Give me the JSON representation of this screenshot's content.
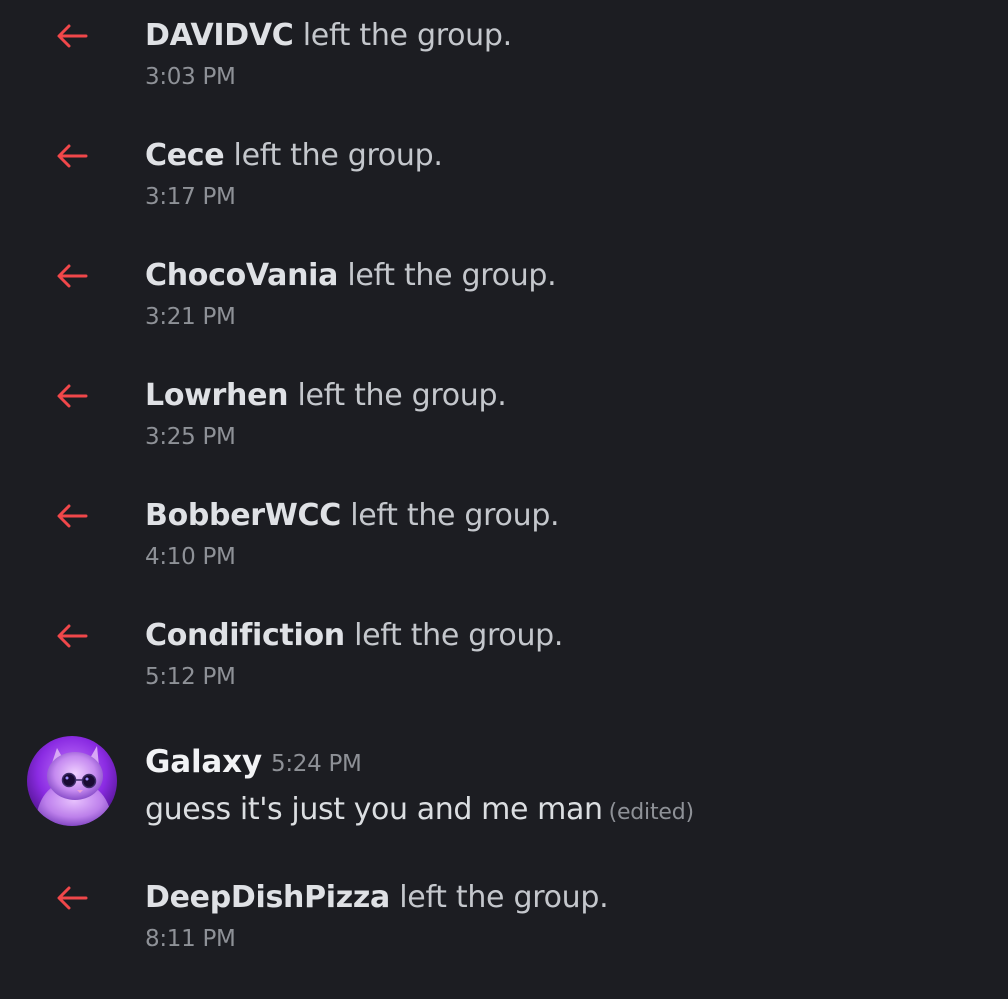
{
  "events": [
    {
      "username": "DAVIDVC",
      "text": " left the group.",
      "time": "3:03 PM"
    },
    {
      "username": "Cece",
      "text": " left the group.",
      "time": "3:17 PM"
    },
    {
      "username": "ChocoVania",
      "text": " left the group.",
      "time": "3:21 PM"
    },
    {
      "username": "Lowrhen",
      "text": " left the group.",
      "time": "3:25 PM"
    },
    {
      "username": "BobberWCC",
      "text": " left the group.",
      "time": "4:10 PM"
    },
    {
      "username": "Condifiction",
      "text": " left the group.",
      "time": "5:12 PM"
    }
  ],
  "message": {
    "author": "Galaxy",
    "time": "5:24 PM",
    "content": "guess it's just you and me man",
    "edited": "(edited)"
  },
  "last_event": {
    "username": "DeepDishPizza",
    "text": " left the group.",
    "time": "8:11 PM"
  },
  "colors": {
    "background": "#1c1d22",
    "leave_arrow": "#f0474a",
    "username": "#dfe1e5",
    "timestamp": "#8e9197"
  },
  "icons": {
    "leave": "arrow-left-icon",
    "avatar": "purple-cat-avatar"
  }
}
